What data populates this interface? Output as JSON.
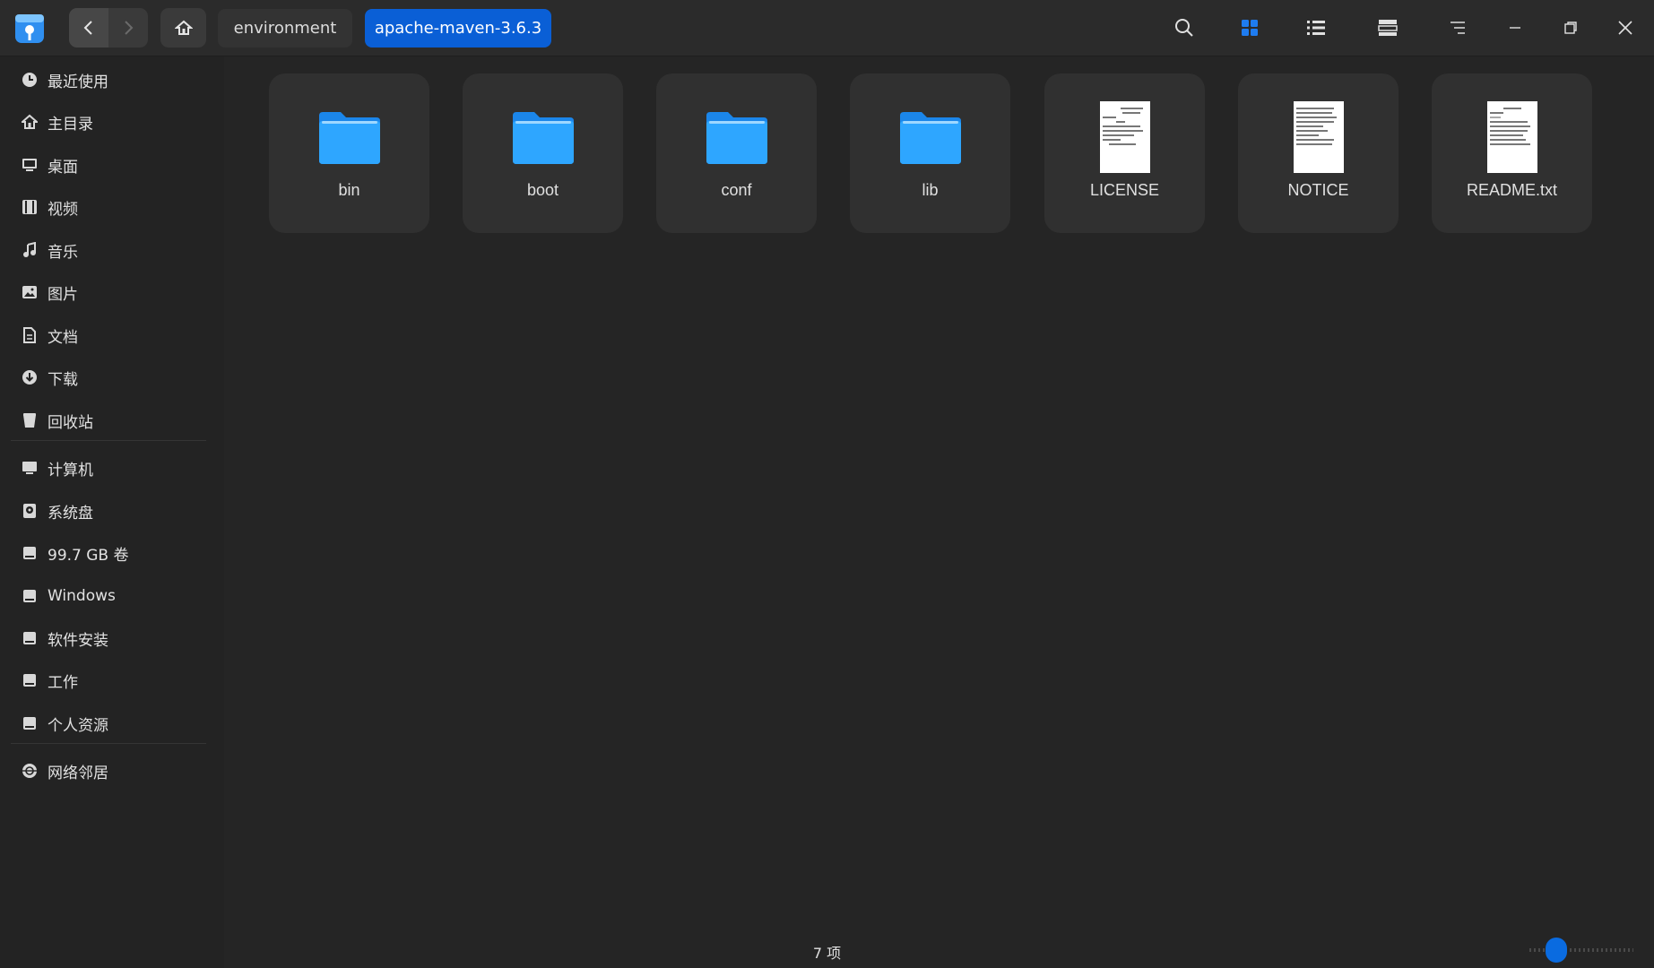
{
  "toolbar": {
    "breadcrumbs": [
      "environment",
      "apache-maven-3.6.3"
    ],
    "icons": [
      "app-logo",
      "back-icon",
      "forward-icon",
      "home-icon",
      "search-icon",
      "grid-view-icon",
      "list-view-icon",
      "tree-view-icon",
      "menu-icon",
      "minimize-icon",
      "restore-icon",
      "close-icon"
    ]
  },
  "sidebar": {
    "items": [
      {
        "label": "最近使用",
        "icon": "clock-icon"
      },
      {
        "label": "主目录",
        "icon": "home-icon"
      },
      {
        "label": "桌面",
        "icon": "desktop-icon"
      },
      {
        "label": "视频",
        "icon": "video-icon"
      },
      {
        "label": "音乐",
        "icon": "music-icon"
      },
      {
        "label": "图片",
        "icon": "image-icon"
      },
      {
        "label": "文档",
        "icon": "document-icon"
      },
      {
        "label": "下载",
        "icon": "download-icon"
      },
      {
        "label": "回收站",
        "icon": "trash-icon"
      }
    ],
    "devices": [
      {
        "label": "计算机",
        "icon": "computer-icon"
      },
      {
        "label": "系统盘",
        "icon": "system-disk-icon"
      },
      {
        "label": "99.7 GB 卷",
        "icon": "disk-icon"
      },
      {
        "label": "Windows",
        "icon": "disk-icon"
      },
      {
        "label": "软件安装",
        "icon": "disk-icon"
      },
      {
        "label": "工作",
        "icon": "disk-icon"
      },
      {
        "label": "个人资源",
        "icon": "disk-icon"
      }
    ],
    "network": [
      {
        "label": "网络邻居",
        "icon": "network-icon"
      }
    ]
  },
  "files": [
    {
      "name": "bin",
      "type": "folder"
    },
    {
      "name": "boot",
      "type": "folder"
    },
    {
      "name": "conf",
      "type": "folder"
    },
    {
      "name": "lib",
      "type": "folder"
    },
    {
      "name": "LICENSE",
      "type": "text"
    },
    {
      "name": "NOTICE",
      "type": "text"
    },
    {
      "name": "README.txt",
      "type": "text"
    }
  ],
  "status": {
    "item_count": "7 项"
  },
  "colors": {
    "accent": "#0a5fd6",
    "folder": "#2b9bf4",
    "background": "#252525"
  }
}
